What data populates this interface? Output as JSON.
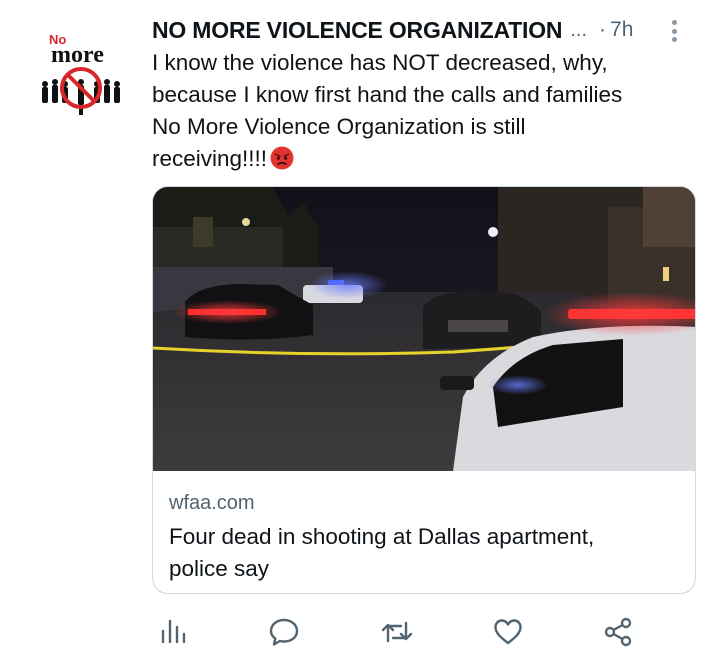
{
  "author": {
    "name": "NO MORE VIOLENCE ORGANIZATION",
    "ellipsis": "...",
    "dot": "·",
    "time": "7h",
    "avatar_text_top": "No",
    "avatar_text_main": "more"
  },
  "tweet": {
    "lines": [
      "I know the violence has NOT decreased, why,",
      "because I know first hand the calls and families",
      "No More Violence Organization  is still",
      "receiving!!!!"
    ],
    "emoji": "angry-face"
  },
  "card": {
    "domain": "wfaa.com",
    "title_lines": [
      "Four dead in shooting at Dallas apartment,",
      "police say"
    ]
  },
  "actions": {
    "icons": [
      "analytics-icon",
      "reply-icon",
      "retweet-icon",
      "like-icon",
      "share-icon"
    ]
  },
  "colors": {
    "text": "#0f1419",
    "secondary": "#536471",
    "border": "#cfd9de",
    "brand_red": "#d9262c"
  }
}
